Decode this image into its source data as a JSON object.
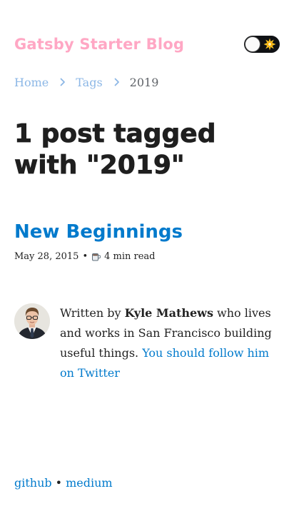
{
  "site": {
    "title": "Gatsby Starter Blog"
  },
  "theme_toggle": {
    "icon": "sun-icon"
  },
  "breadcrumb": {
    "items": [
      "Home",
      "Tags"
    ],
    "current": "2019"
  },
  "page": {
    "title": "1 post tagged with \"2019\""
  },
  "post": {
    "title": "New Beginnings",
    "date": "May 28, 2015",
    "separator": "•",
    "read_icon": "coffee-cup-icon",
    "read_time": "4 min read"
  },
  "bio": {
    "written_by": "Written by ",
    "author": "Kyle Mathews",
    "description": " who lives and works in San Francisco building useful things. ",
    "follow_link": "You should follow him on Twitter"
  },
  "footer": {
    "links": [
      "github",
      "medium"
    ],
    "separator": "•"
  },
  "colors": {
    "brand_pink": "#ffa7c4",
    "link_blue": "#007acc",
    "breadcrumb_link": "#8cb7e6",
    "text": "#222222",
    "toggle_bg": "#0f1114"
  }
}
